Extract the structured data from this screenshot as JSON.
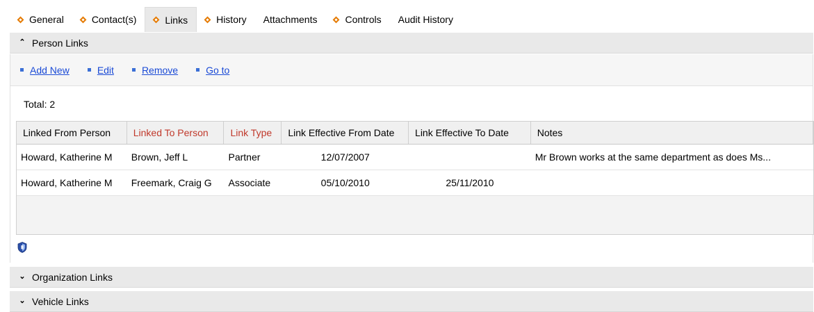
{
  "tabs": [
    {
      "label": "General",
      "marker": true,
      "active": false
    },
    {
      "label": "Contact(s)",
      "marker": true,
      "active": false
    },
    {
      "label": "Links",
      "marker": true,
      "active": true
    },
    {
      "label": "History",
      "marker": true,
      "active": false
    },
    {
      "label": "Attachments",
      "marker": false,
      "active": false
    },
    {
      "label": "Controls",
      "marker": true,
      "active": false
    },
    {
      "label": "Audit History",
      "marker": false,
      "active": false
    }
  ],
  "person_links": {
    "title": "Person Links",
    "actions": {
      "add_new": "Add New",
      "edit": "Edit",
      "remove": "Remove",
      "go_to": "Go to"
    },
    "total": "Total: 2",
    "columns": [
      "Linked From Person",
      "Linked To Person",
      "Link Type",
      "Link Effective From Date",
      "Link Effective To Date",
      "Notes"
    ],
    "rows": [
      {
        "from": "Howard, Katherine M",
        "to": "Brown, Jeff L",
        "type": "Partner",
        "effective_from": "12/07/2007",
        "effective_to": "",
        "notes": "Mr Brown works at the same department as does Ms..."
      },
      {
        "from": "Howard, Katherine M",
        "to": "Freemark, Craig G",
        "type": "Associate",
        "effective_from": "05/10/2010",
        "effective_to": "25/11/2010",
        "notes": ""
      }
    ]
  },
  "organization_links": {
    "title": "Organization Links"
  },
  "vehicle_links": {
    "title": "Vehicle Links"
  },
  "colors": {
    "tab_marker": "#e57a00",
    "link": "#1a4ad6",
    "required_header": "#c0392b",
    "section_bg": "#e9e9e9"
  },
  "icons": {
    "tab_marker": "diamond-icon",
    "collapse": "chevron-up-double-icon",
    "expand": "chevron-down-double-icon",
    "action_bullet": "square-bullet-icon",
    "grid_footer": "shield-icon"
  }
}
